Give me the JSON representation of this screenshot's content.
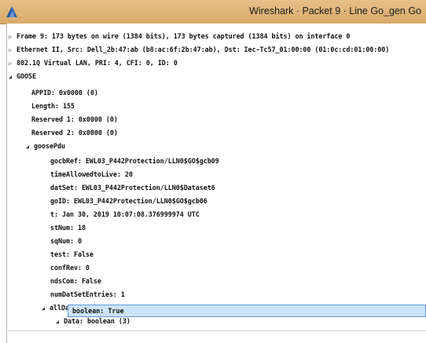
{
  "window": {
    "title": "Wireshark · Packet 9 · Line Go_gen Go"
  },
  "tree": [
    {
      "text": "Frame 9: 173 bytes on wire (1384 bits), 173 bytes captured (1384 bits) on interface 0",
      "state": "collapsed"
    },
    {
      "text": "Ethernet II, Src: Dell_2b:47:ab (b8:ac:6f:2b:47:ab), Dst: Iec-Tc57_01:00:00 (01:0c:cd:01:00:00)",
      "state": "collapsed"
    },
    {
      "text": "802.1Q Virtual LAN, PRI: 4, CFI: 0, ID: 0",
      "state": "collapsed"
    },
    {
      "text": "GOOSE",
      "state": "expanded"
    },
    {
      "text": "APPID: 0x0000 (0)",
      "state": "leaf"
    },
    {
      "text": "Length: 155",
      "state": "leaf"
    },
    {
      "text": "Reserved 1: 0x0000 (0)",
      "state": "leaf"
    },
    {
      "text": "Reserved 2: 0x0000 (0)",
      "state": "leaf"
    },
    {
      "text": "goosePdu",
      "state": "expanded"
    },
    {
      "text": "gocbRef: EWL03_P442Protection/LLN0$GO$gcb09",
      "state": "leaf"
    },
    {
      "text": "timeAllowedtoLive: 20",
      "state": "leaf"
    },
    {
      "text": "datSet: EWL03_P442Protection/LLN0$Dataset6",
      "state": "leaf"
    },
    {
      "text": "goID: EWL03_P442Protection/LLN0$GO$gcb06",
      "state": "leaf"
    },
    {
      "text": "t: Jan 30, 2019 10:07:08.376999974 UTC",
      "state": "leaf"
    },
    {
      "text": "stNum: 18",
      "state": "leaf"
    },
    {
      "text": "sqNum: 0",
      "state": "leaf"
    },
    {
      "text": "test: False",
      "state": "leaf"
    },
    {
      "text": "confRev: 0",
      "state": "leaf"
    },
    {
      "text": "ndsCom: False",
      "state": "leaf"
    },
    {
      "text": "numDatSetEntries: 1",
      "state": "leaf"
    },
    {
      "text": "allData: 1 item",
      "state": "expanded"
    },
    {
      "text": "Data: boolean (3)",
      "state": "expanded"
    }
  ],
  "selected": {
    "text": "boolean: True"
  },
  "icons": {
    "collapsed": "triangle-right-icon",
    "expanded": "triangle-down-icon"
  },
  "colors": {
    "titlebar": "#dcb078",
    "selection": "#cde3f8",
    "selection_border": "#5a9be0"
  }
}
